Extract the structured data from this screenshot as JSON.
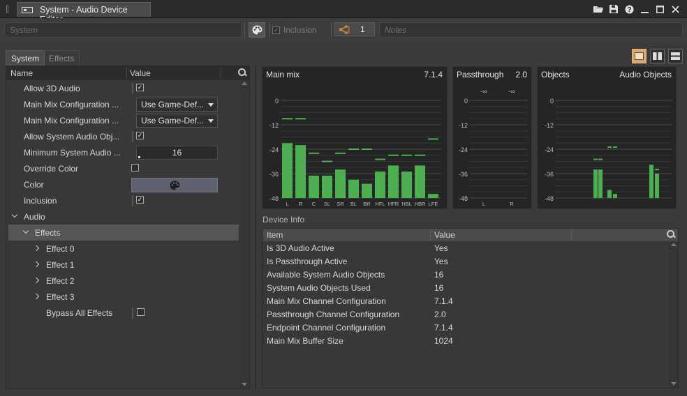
{
  "window": {
    "title": "System - Audio Device Editor"
  },
  "title_icons": [
    "folder-icon",
    "save-icon",
    "help-icon",
    "minimize-icon",
    "maximize-icon",
    "close-icon"
  ],
  "toolbar": {
    "name_value": "System",
    "inclusion_label": "Inclusion",
    "inclusion_checked": true,
    "reference_count": "1",
    "notes_placeholder": "Notes"
  },
  "tabs": [
    {
      "label": "System",
      "active": true
    },
    {
      "label": "Effects",
      "active": false
    }
  ],
  "layout_buttons": [
    "layout-single-icon",
    "layout-columns-icon",
    "layout-rows-icon"
  ],
  "props": {
    "header": {
      "name": "Name",
      "value": "Value"
    },
    "allow3d": {
      "label": "Allow 3D Audio",
      "checked": true
    },
    "mainmix1": {
      "label": "Main Mix Configuration ...",
      "value": "Use Game-Def..."
    },
    "mainmix2": {
      "label": "Main Mix Configuration ...",
      "value": "Use Game-Def..."
    },
    "allowsys": {
      "label": "Allow System Audio Obj...",
      "checked": true
    },
    "minsys": {
      "label": "Minimum System Audio ...",
      "value": "16"
    },
    "override": {
      "label": "Override Color",
      "checked": false
    },
    "color": {
      "label": "Color"
    },
    "inclusion": {
      "label": "Inclusion",
      "checked": true
    },
    "audio": {
      "label": "Audio"
    },
    "effects": {
      "label": "Effects"
    },
    "effect0": {
      "label": "Effect 0"
    },
    "effect1": {
      "label": "Effect 1"
    },
    "effect2": {
      "label": "Effect 2"
    },
    "effect3": {
      "label": "Effect 3"
    },
    "bypass": {
      "label": "Bypass All Effects",
      "checked": false
    }
  },
  "meters": {
    "main": {
      "title": "Main mix",
      "config": "7.1.4",
      "scale": [
        "0",
        "-12",
        "-24",
        "-36",
        "-48"
      ],
      "channels": [
        "L",
        "R",
        "C",
        "SL",
        "SR",
        "BL",
        "BR",
        "HFL",
        "HFR",
        "HBL",
        "HBR",
        "LFE"
      ],
      "levels": [
        -21,
        -22,
        -37,
        -37,
        -34,
        -39,
        -41,
        -35,
        -32,
        -35,
        -32,
        -46
      ],
      "peaks": [
        -9,
        -9,
        -26,
        -30,
        -26,
        -24,
        -24,
        -29,
        -27,
        -27,
        -27,
        -19
      ]
    },
    "pass": {
      "title": "Passthrough",
      "config": "2.0",
      "scale": [
        "0",
        "-12",
        "-24",
        "-36",
        "-48"
      ],
      "channels": [
        "L",
        "R"
      ],
      "readouts": [
        "-∞",
        "-∞"
      ]
    },
    "objects": {
      "title": "Objects",
      "config": "Audio Objects",
      "scale": [
        "0",
        "-12",
        "-24",
        "-36",
        "-48"
      ],
      "levels": [
        -34,
        -34,
        -44,
        -46,
        -32,
        -36
      ],
      "peaks": [
        -29,
        -29,
        -23,
        -23,
        -32,
        -34
      ]
    }
  },
  "device_info": {
    "label": "Device Info",
    "header": {
      "item": "Item",
      "value": "Value"
    },
    "rows": [
      {
        "item": "Is 3D Audio Active",
        "value": "Yes"
      },
      {
        "item": "Is Passthrough Active",
        "value": "Yes"
      },
      {
        "item": "Available System Audio Objects",
        "value": "16"
      },
      {
        "item": "System Audio Objects Used",
        "value": "16"
      },
      {
        "item": "Main Mix Channel Configuration",
        "value": "7.1.4"
      },
      {
        "item": "Passthrough Channel Configuration",
        "value": "2.0"
      },
      {
        "item": "Endpoint Channel Configuration",
        "value": "7.1.4"
      },
      {
        "item": "Main Mix Buffer Size",
        "value": "1024"
      }
    ]
  },
  "colors": {
    "meter_green": "#4caf50",
    "accent": "#d9a86a",
    "selection": "#555555"
  }
}
